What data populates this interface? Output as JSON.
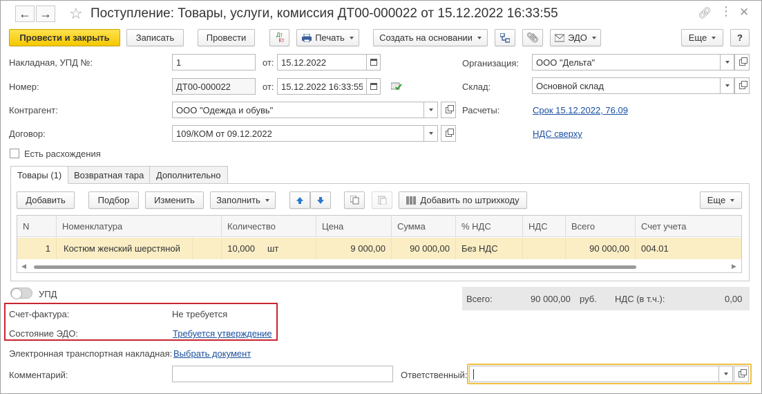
{
  "window": {
    "title": "Поступление: Товары, услуги, комиссия ДТ00-000022 от 15.12.2022 16:33:55",
    "back_icon": "arrow-left-icon",
    "forward_icon": "arrow-right-icon"
  },
  "toolbar": {
    "post_close": "Провести и закрыть",
    "save": "Записать",
    "post": "Провести",
    "dtkt_dt": "Дт",
    "dtkt_kt": "Кт",
    "print": "Печать",
    "create_based": "Создать на основании",
    "edo": "ЭДО",
    "more": "Еще",
    "help": "?"
  },
  "header": {
    "invoice_label": "Накладная, УПД №:",
    "invoice_value": "1",
    "from_label": "от:",
    "invoice_date": "15.12.2022",
    "number_label": "Номер:",
    "number_value": "ДТ00-000022",
    "number_date": "15.12.2022 16:33:55",
    "contractor_label": "Контрагент:",
    "contractor_value": "ООО \"Одежда и обувь\"",
    "contract_label": "Договор:",
    "contract_value": "109/КОМ от 09.12.2022",
    "discrepancy_label": "Есть расхождения",
    "org_label": "Организация:",
    "org_value": "ООО \"Дельта\"",
    "warehouse_label": "Склад:",
    "warehouse_value": "Основной склад",
    "settlements_label": "Расчеты:",
    "settlements_link": "Срок 15.12.2022, 76.09",
    "vat_link": "НДС сверху"
  },
  "tabs": [
    {
      "label": "Товары (1)"
    },
    {
      "label": "Возвратная тара"
    },
    {
      "label": "Дополнительно"
    }
  ],
  "table_toolbar": {
    "add": "Добавить",
    "pick": "Подбор",
    "change": "Изменить",
    "fill": "Заполнить",
    "barcode": "Добавить по штрихкоду",
    "more": "Еще"
  },
  "table": {
    "columns": [
      "N",
      "Номенклатура",
      "Количество",
      "Цена",
      "Сумма",
      "% НДС",
      "НДС",
      "Всего",
      "Счет учета"
    ],
    "rows": [
      {
        "n": "1",
        "item": "Костюм женский шерстяной",
        "qty": "10,000",
        "unit": "шт",
        "price": "9 000,00",
        "sum": "90 000,00",
        "vat_rate": "Без НДС",
        "vat": "",
        "total": "90 000,00",
        "account": "004.01"
      }
    ]
  },
  "footer": {
    "upd_label": "УПД",
    "total_label": "Всего:",
    "total_value": "90 000,00",
    "currency": "руб.",
    "vat_incl_label": "НДС (в т.ч.):",
    "vat_incl_value": "0,00",
    "invoice_label": "Счет-фактура:",
    "invoice_value": "Не требуется",
    "edo_state_label": "Состояние ЭДО:",
    "edo_state_link": "Требуется утверждение",
    "etn_label": "Электронная транспортная накладная:",
    "etn_link": "Выбрать документ",
    "comment_label": "Комментарий:",
    "comment_value": "",
    "responsible_label": "Ответственный:",
    "responsible_value": ""
  },
  "colors": {
    "primary_button": "#f5c800",
    "selected_row": "#fbeec5",
    "highlight_box": "#c8252f",
    "link": "#1a4fa0",
    "focus_border": "#f0c040"
  }
}
